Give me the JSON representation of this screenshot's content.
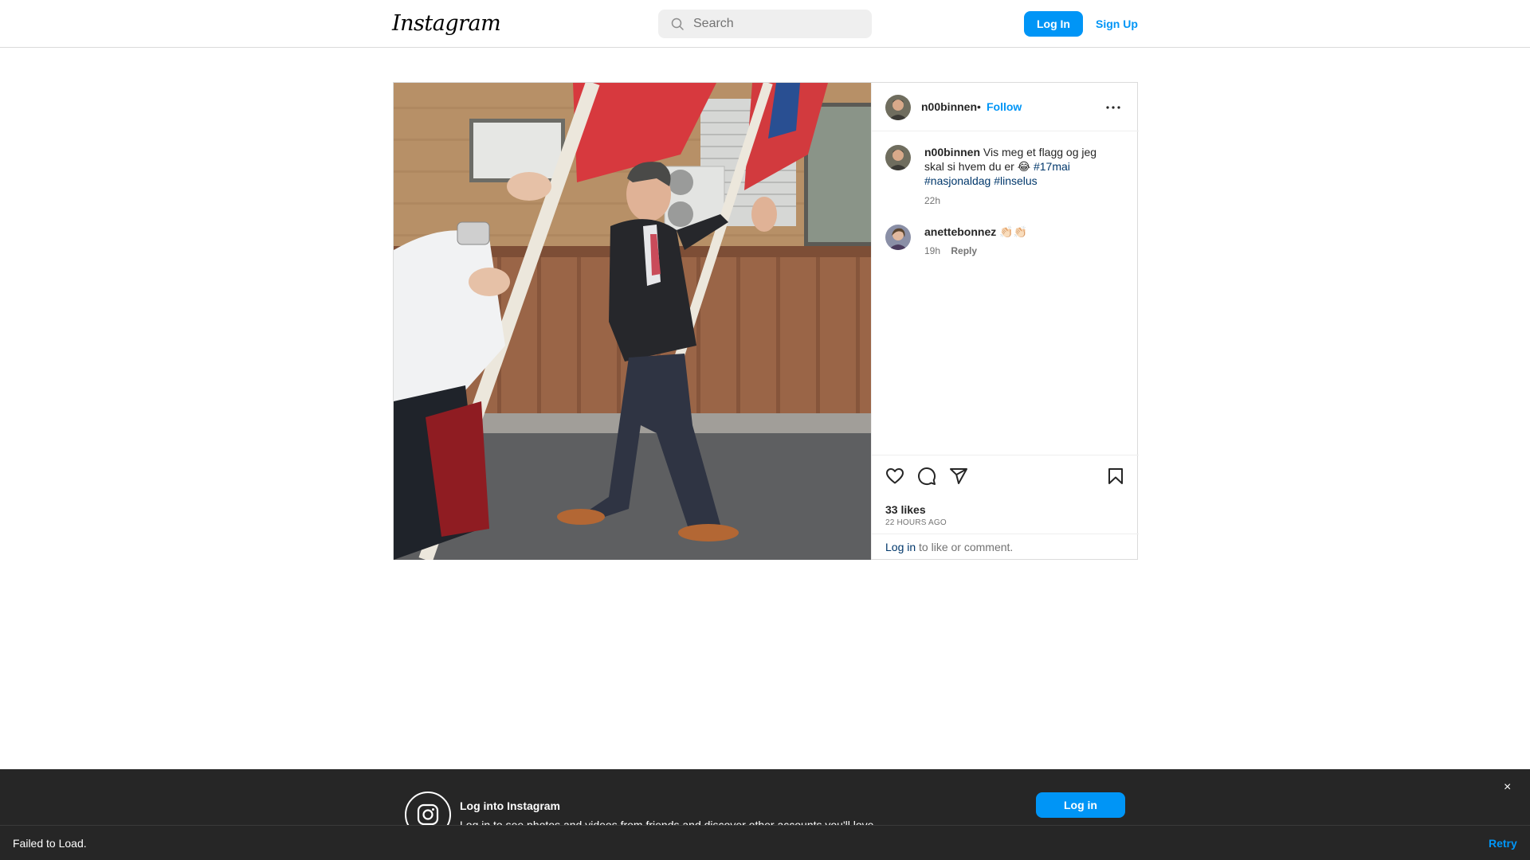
{
  "nav": {
    "logo": "Instagram",
    "search_placeholder": "Search",
    "login_label": "Log In",
    "signup_label": "Sign Up"
  },
  "post": {
    "author": {
      "username": "n00binnen",
      "separator": "•",
      "follow_label": "Follow"
    },
    "caption": {
      "username": "n00binnen",
      "text": "Vis meg et flagg og jeg skal si hvem du er 😂",
      "hashtags": [
        "#17mai",
        "#nasjonaldag",
        "#linselus"
      ],
      "age": "22h"
    },
    "comments": [
      {
        "username": "anettebonnez",
        "text": "👏🏻👏🏻",
        "age": "19h",
        "reply_label": "Reply"
      }
    ],
    "likes": "33 likes",
    "time_ago": "22 HOURS AGO",
    "login_prompt": {
      "link": "Log in",
      "rest": "to like or comment."
    }
  },
  "banner": {
    "title": "Log into Instagram",
    "subtitle": "Log in to see photos and videos from friends and discover other accounts you'll love.",
    "login_label": "Log in",
    "close": "×"
  },
  "toast": {
    "message": "Failed to Load.",
    "retry_label": "Retry"
  },
  "colors": {
    "accent": "#0095f6",
    "link": "#00376b",
    "border": "#dbdbdb",
    "banner_bg": "#262626"
  }
}
